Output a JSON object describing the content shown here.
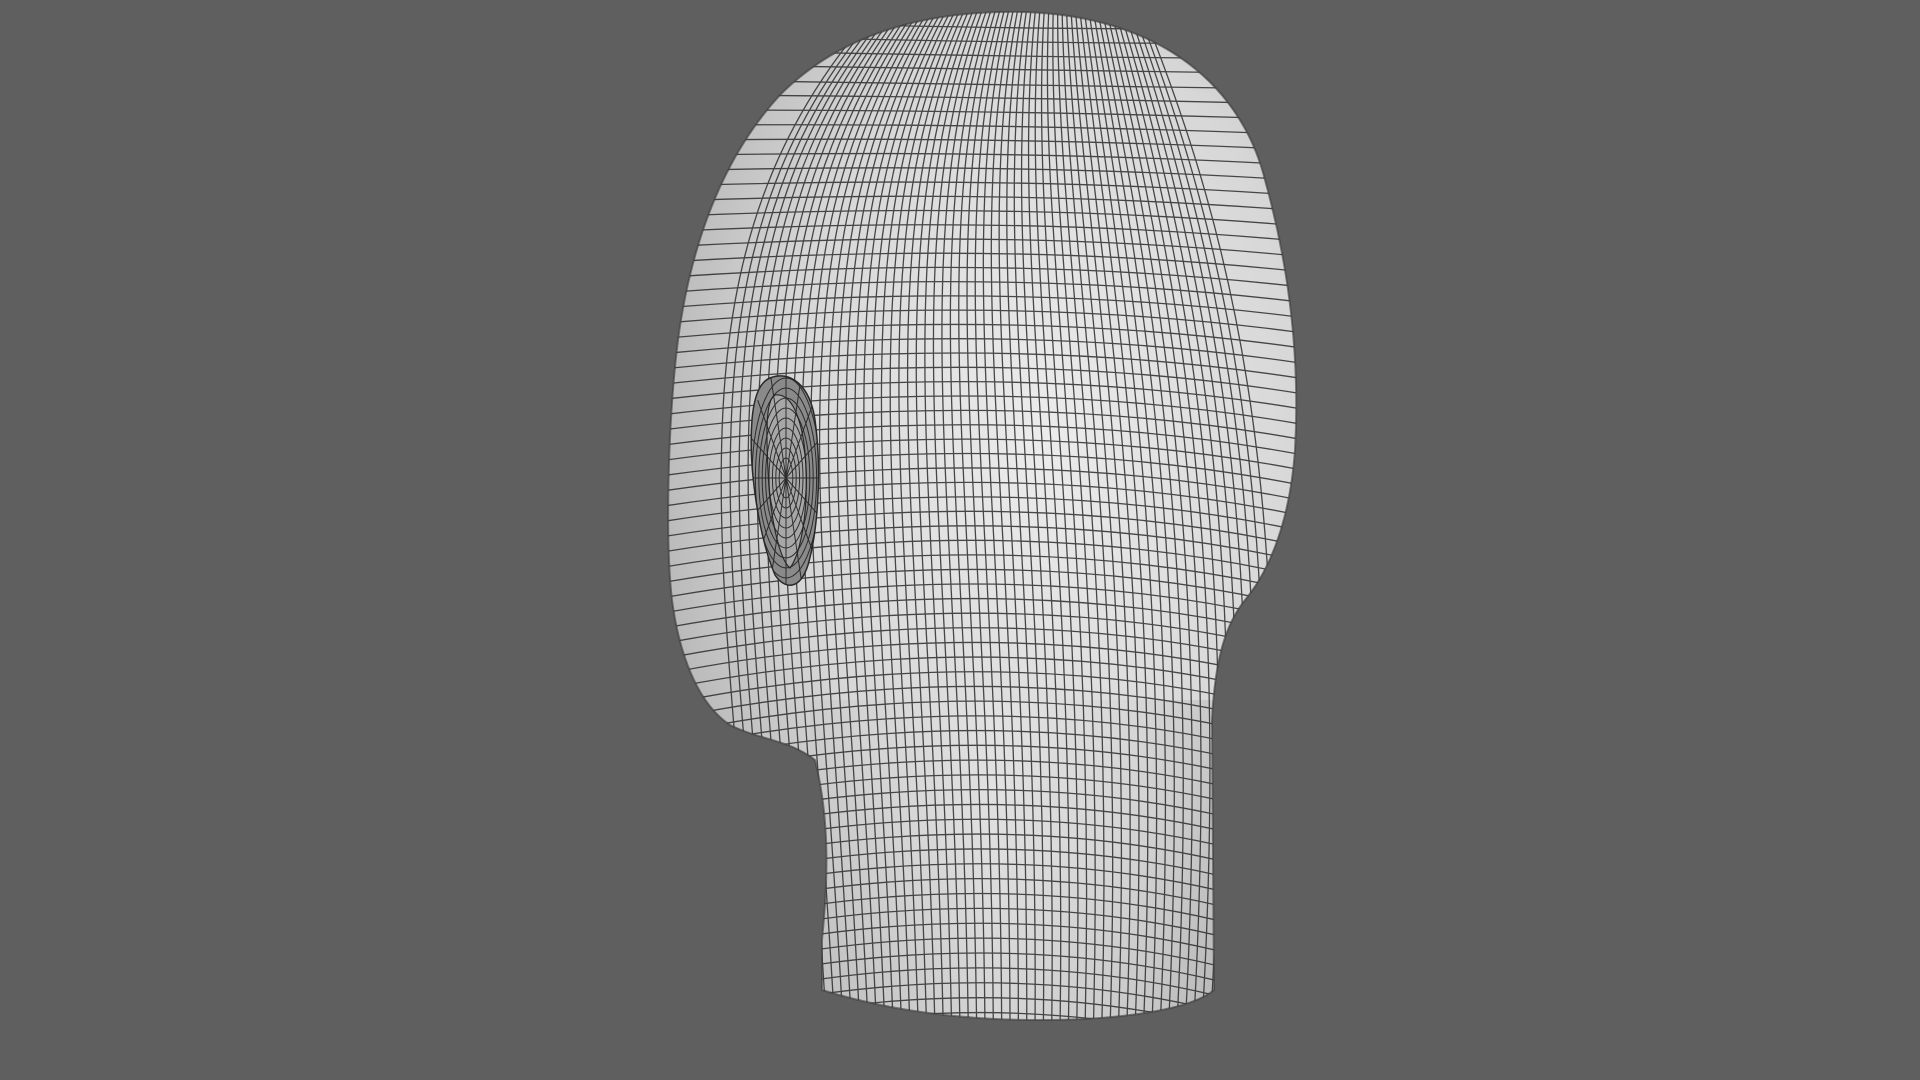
{
  "scene": {
    "background_color": "#5f5f5f",
    "mesh_color": "#d9d9d9",
    "wire_color": "#2a2a2a",
    "subject": "head-mesh"
  }
}
